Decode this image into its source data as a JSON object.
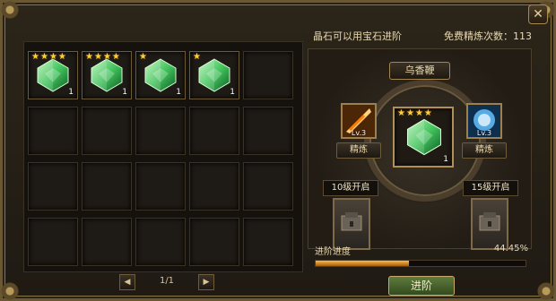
{
  "inventory": {
    "slots": [
      {
        "filled": true,
        "stars": 4,
        "count": "1"
      },
      {
        "filled": true,
        "stars": 4,
        "count": "1"
      },
      {
        "filled": true,
        "stars": 1,
        "count": "1"
      },
      {
        "filled": true,
        "stars": 1,
        "count": "1"
      },
      {
        "filled": false
      },
      {
        "filled": false
      },
      {
        "filled": false
      },
      {
        "filled": false
      },
      {
        "filled": false
      },
      {
        "filled": false
      },
      {
        "filled": false
      },
      {
        "filled": false
      },
      {
        "filled": false
      },
      {
        "filled": false
      },
      {
        "filled": false
      },
      {
        "filled": false
      },
      {
        "filled": false
      },
      {
        "filled": false
      },
      {
        "filled": false
      },
      {
        "filled": false
      }
    ],
    "page_text": "1/1",
    "prev_icon": "◀",
    "next_icon": "▶"
  },
  "right": {
    "hint_text": "晶石可以用宝石进阶",
    "free_refine_text": "免费精炼次数：113",
    "item_name": "乌香鞭",
    "center_gem": {
      "stars": 4,
      "count": "1"
    },
    "skill_left": {
      "level": "Lv.3",
      "button": "精炼"
    },
    "skill_right": {
      "level": "Lv.3",
      "button": "精炼"
    },
    "unlock_left": "10级开启",
    "unlock_right": "15级开启",
    "progress_label": "进阶进度",
    "progress_value_text": "44.45%",
    "progress_fraction": 0.4445,
    "advance_button": "进阶",
    "close_icon": "✕"
  },
  "colors": {
    "gem": "#43c45d",
    "gold": "#ffcf3a"
  }
}
